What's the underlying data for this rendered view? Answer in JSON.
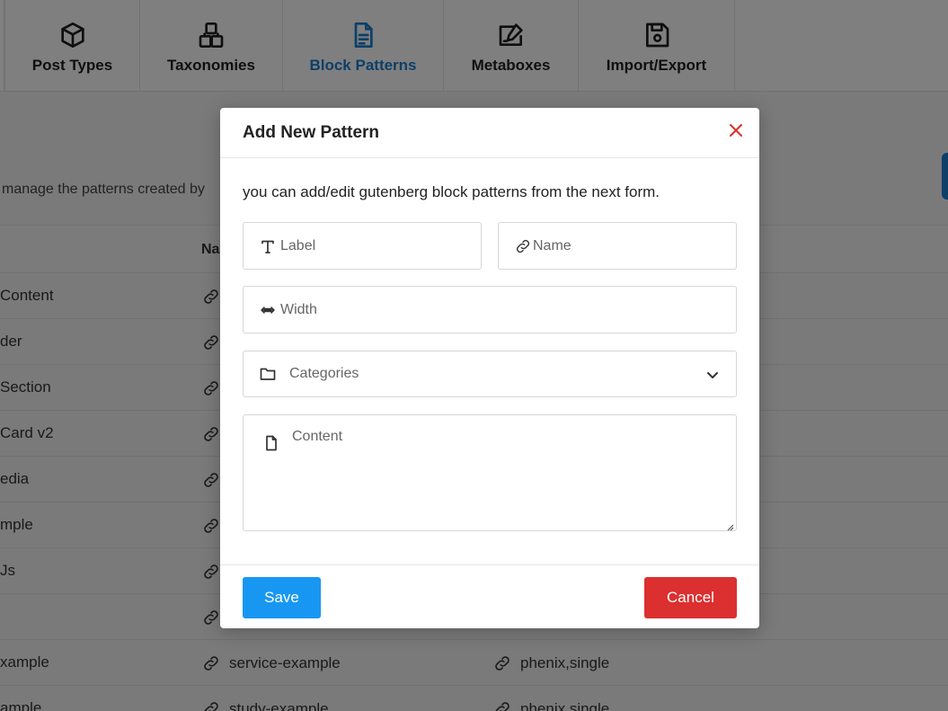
{
  "nav": {
    "tabs": [
      {
        "label": "Post Types",
        "icon": "cube-icon"
      },
      {
        "label": "Taxonomies",
        "icon": "blocks-icon"
      },
      {
        "label": "Block Patterns",
        "icon": "document-icon",
        "active": true
      },
      {
        "label": "Metaboxes",
        "icon": "edit-box-icon"
      },
      {
        "label": "Import/Export",
        "icon": "floppy-disk-icon"
      }
    ]
  },
  "page": {
    "description": "manage the patterns created by",
    "table": {
      "header_name": "Na",
      "rows": [
        {
          "label": "Content",
          "name": "",
          "categories": ""
        },
        {
          "label": "der",
          "name": "",
          "categories": ""
        },
        {
          "label": " Section",
          "name": "",
          "categories": ""
        },
        {
          "label": "Card v2",
          "name": "",
          "categories": ""
        },
        {
          "label": "edia",
          "name": "",
          "categories": ""
        },
        {
          "label": "mple",
          "name": "",
          "categories": ""
        },
        {
          "label": "Js",
          "name": "",
          "categories": ""
        },
        {
          "label": "",
          "name": "",
          "categories": ""
        },
        {
          "label": "xample",
          "name": "service-example",
          "categories": "phenix,single"
        },
        {
          "label": "ample",
          "name": "study-example",
          "categories": "phenix,single"
        }
      ]
    }
  },
  "modal": {
    "title": "Add New Pattern",
    "intro": "you can add/edit gutenberg block patterns from the next form.",
    "fields": {
      "label_placeholder": "Label",
      "name_placeholder": "Name",
      "width_placeholder": "Width",
      "categories_placeholder": "Categories",
      "content_placeholder": "Content"
    },
    "save_label": "Save",
    "cancel_label": "Cancel"
  },
  "colors": {
    "primary": "#1897f2",
    "danger": "#dc2f2f",
    "active_tab": "#1a7fd0"
  }
}
